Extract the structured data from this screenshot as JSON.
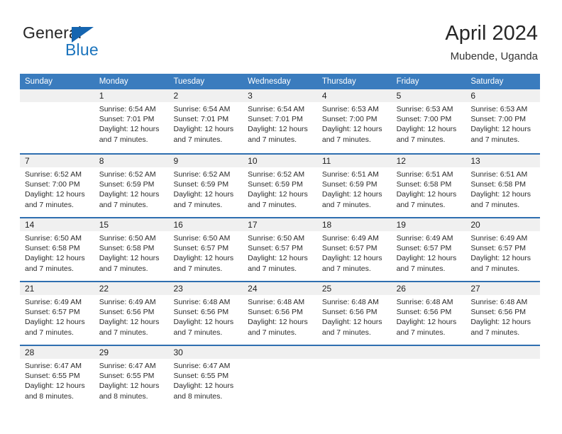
{
  "brand": {
    "name_part1": "General",
    "name_part2": "Blue",
    "triangle_icon": "blue-triangle-logo-icon",
    "color_dark": "#262626",
    "color_blue": "#1b74bd"
  },
  "header": {
    "title": "April 2024",
    "subtitle": "Mubende, Uganda"
  },
  "calendar": {
    "accent_color": "#3a7cbe",
    "row_divider_color": "#2f6fb0",
    "day_band_color": "#f0f0f0",
    "weekdays": [
      "Sunday",
      "Monday",
      "Tuesday",
      "Wednesday",
      "Thursday",
      "Friday",
      "Saturday"
    ],
    "weeks": [
      [
        {
          "day": "",
          "lines": []
        },
        {
          "day": "1",
          "lines": [
            "Sunrise: 6:54 AM",
            "Sunset: 7:01 PM",
            "Daylight: 12 hours",
            "and 7 minutes."
          ]
        },
        {
          "day": "2",
          "lines": [
            "Sunrise: 6:54 AM",
            "Sunset: 7:01 PM",
            "Daylight: 12 hours",
            "and 7 minutes."
          ]
        },
        {
          "day": "3",
          "lines": [
            "Sunrise: 6:54 AM",
            "Sunset: 7:01 PM",
            "Daylight: 12 hours",
            "and 7 minutes."
          ]
        },
        {
          "day": "4",
          "lines": [
            "Sunrise: 6:53 AM",
            "Sunset: 7:00 PM",
            "Daylight: 12 hours",
            "and 7 minutes."
          ]
        },
        {
          "day": "5",
          "lines": [
            "Sunrise: 6:53 AM",
            "Sunset: 7:00 PM",
            "Daylight: 12 hours",
            "and 7 minutes."
          ]
        },
        {
          "day": "6",
          "lines": [
            "Sunrise: 6:53 AM",
            "Sunset: 7:00 PM",
            "Daylight: 12 hours",
            "and 7 minutes."
          ]
        }
      ],
      [
        {
          "day": "7",
          "lines": [
            "Sunrise: 6:52 AM",
            "Sunset: 7:00 PM",
            "Daylight: 12 hours",
            "and 7 minutes."
          ]
        },
        {
          "day": "8",
          "lines": [
            "Sunrise: 6:52 AM",
            "Sunset: 6:59 PM",
            "Daylight: 12 hours",
            "and 7 minutes."
          ]
        },
        {
          "day": "9",
          "lines": [
            "Sunrise: 6:52 AM",
            "Sunset: 6:59 PM",
            "Daylight: 12 hours",
            "and 7 minutes."
          ]
        },
        {
          "day": "10",
          "lines": [
            "Sunrise: 6:52 AM",
            "Sunset: 6:59 PM",
            "Daylight: 12 hours",
            "and 7 minutes."
          ]
        },
        {
          "day": "11",
          "lines": [
            "Sunrise: 6:51 AM",
            "Sunset: 6:59 PM",
            "Daylight: 12 hours",
            "and 7 minutes."
          ]
        },
        {
          "day": "12",
          "lines": [
            "Sunrise: 6:51 AM",
            "Sunset: 6:58 PM",
            "Daylight: 12 hours",
            "and 7 minutes."
          ]
        },
        {
          "day": "13",
          "lines": [
            "Sunrise: 6:51 AM",
            "Sunset: 6:58 PM",
            "Daylight: 12 hours",
            "and 7 minutes."
          ]
        }
      ],
      [
        {
          "day": "14",
          "lines": [
            "Sunrise: 6:50 AM",
            "Sunset: 6:58 PM",
            "Daylight: 12 hours",
            "and 7 minutes."
          ]
        },
        {
          "day": "15",
          "lines": [
            "Sunrise: 6:50 AM",
            "Sunset: 6:58 PM",
            "Daylight: 12 hours",
            "and 7 minutes."
          ]
        },
        {
          "day": "16",
          "lines": [
            "Sunrise: 6:50 AM",
            "Sunset: 6:57 PM",
            "Daylight: 12 hours",
            "and 7 minutes."
          ]
        },
        {
          "day": "17",
          "lines": [
            "Sunrise: 6:50 AM",
            "Sunset: 6:57 PM",
            "Daylight: 12 hours",
            "and 7 minutes."
          ]
        },
        {
          "day": "18",
          "lines": [
            "Sunrise: 6:49 AM",
            "Sunset: 6:57 PM",
            "Daylight: 12 hours",
            "and 7 minutes."
          ]
        },
        {
          "day": "19",
          "lines": [
            "Sunrise: 6:49 AM",
            "Sunset: 6:57 PM",
            "Daylight: 12 hours",
            "and 7 minutes."
          ]
        },
        {
          "day": "20",
          "lines": [
            "Sunrise: 6:49 AM",
            "Sunset: 6:57 PM",
            "Daylight: 12 hours",
            "and 7 minutes."
          ]
        }
      ],
      [
        {
          "day": "21",
          "lines": [
            "Sunrise: 6:49 AM",
            "Sunset: 6:57 PM",
            "Daylight: 12 hours",
            "and 7 minutes."
          ]
        },
        {
          "day": "22",
          "lines": [
            "Sunrise: 6:49 AM",
            "Sunset: 6:56 PM",
            "Daylight: 12 hours",
            "and 7 minutes."
          ]
        },
        {
          "day": "23",
          "lines": [
            "Sunrise: 6:48 AM",
            "Sunset: 6:56 PM",
            "Daylight: 12 hours",
            "and 7 minutes."
          ]
        },
        {
          "day": "24",
          "lines": [
            "Sunrise: 6:48 AM",
            "Sunset: 6:56 PM",
            "Daylight: 12 hours",
            "and 7 minutes."
          ]
        },
        {
          "day": "25",
          "lines": [
            "Sunrise: 6:48 AM",
            "Sunset: 6:56 PM",
            "Daylight: 12 hours",
            "and 7 minutes."
          ]
        },
        {
          "day": "26",
          "lines": [
            "Sunrise: 6:48 AM",
            "Sunset: 6:56 PM",
            "Daylight: 12 hours",
            "and 7 minutes."
          ]
        },
        {
          "day": "27",
          "lines": [
            "Sunrise: 6:48 AM",
            "Sunset: 6:56 PM",
            "Daylight: 12 hours",
            "and 7 minutes."
          ]
        }
      ],
      [
        {
          "day": "28",
          "lines": [
            "Sunrise: 6:47 AM",
            "Sunset: 6:55 PM",
            "Daylight: 12 hours",
            "and 8 minutes."
          ]
        },
        {
          "day": "29",
          "lines": [
            "Sunrise: 6:47 AM",
            "Sunset: 6:55 PM",
            "Daylight: 12 hours",
            "and 8 minutes."
          ]
        },
        {
          "day": "30",
          "lines": [
            "Sunrise: 6:47 AM",
            "Sunset: 6:55 PM",
            "Daylight: 12 hours",
            "and 8 minutes."
          ]
        },
        {
          "day": "",
          "lines": []
        },
        {
          "day": "",
          "lines": []
        },
        {
          "day": "",
          "lines": []
        },
        {
          "day": "",
          "lines": []
        }
      ]
    ]
  }
}
